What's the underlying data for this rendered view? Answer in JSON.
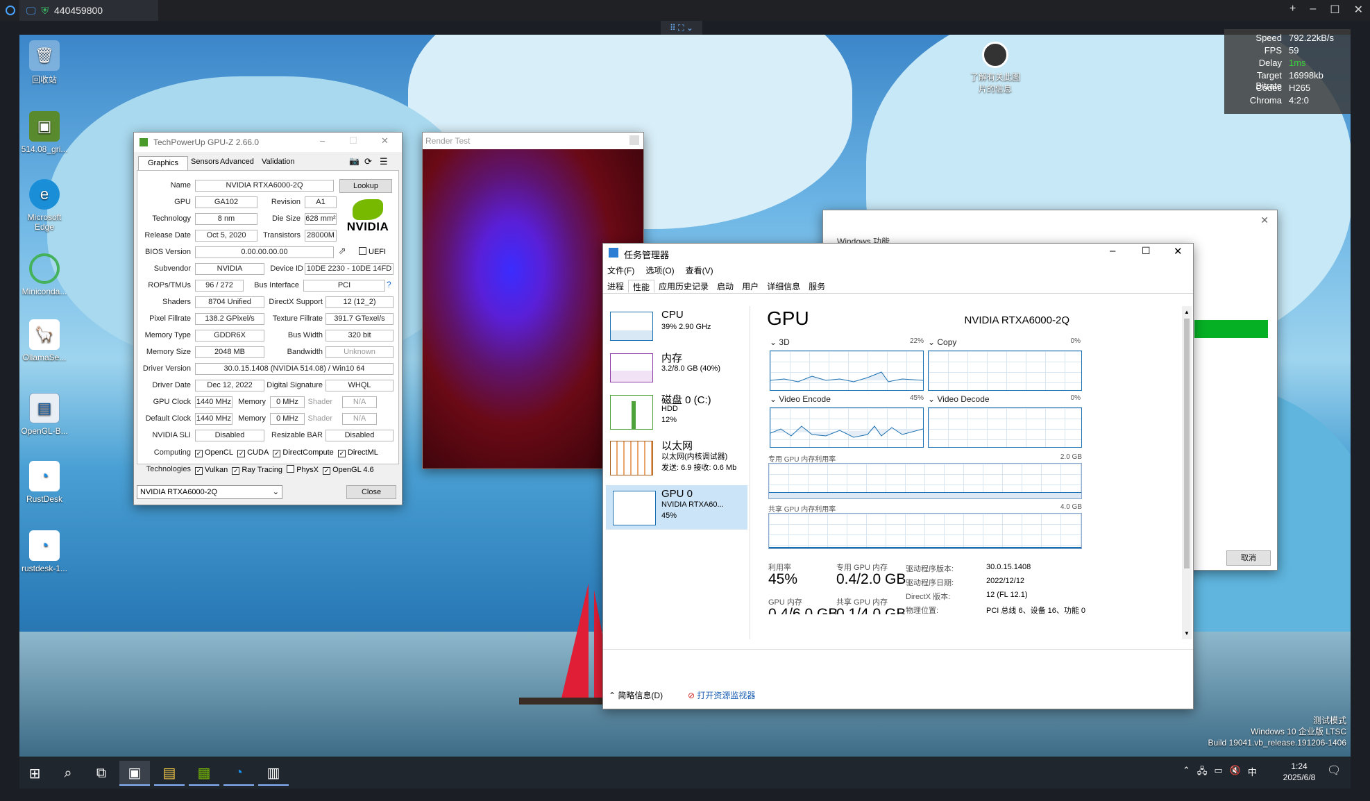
{
  "session": {
    "id": "440459800"
  },
  "stream_stats": [
    {
      "k": "Speed",
      "v": "792.22kB/s"
    },
    {
      "k": "FPS",
      "v": "59"
    },
    {
      "k": "Delay",
      "v": "1ms"
    },
    {
      "k": "Target Bitrate",
      "v": "16998kb"
    },
    {
      "k": "Codec",
      "v": "H265"
    },
    {
      "k": "Chroma",
      "v": "4:2:0"
    }
  ],
  "desktop_icons": [
    "回收站",
    "514.08_gri...",
    "Microsoft Edge",
    "Miniconda...",
    "OllamaSe...",
    "OpenGL-B...",
    "RustDesk",
    "rustdesk-1..."
  ],
  "spotlight_label": "了解有关此图片的信息",
  "watermark": {
    "mode": "测试模式",
    "edition": "Windows 10 企业版 LTSC",
    "build": "Build 19041.vb_release.191206-1406"
  },
  "gpuz": {
    "title": "TechPowerUp GPU-Z 2.66.0",
    "tabs": [
      "Graphics Card",
      "Sensors",
      "Advanced",
      "Validation"
    ],
    "lookup": "Lookup",
    "uefi": "UEFI",
    "close": "Close",
    "selected_gpu": "NVIDIA RTXA6000-2Q",
    "rows": {
      "name": {
        "label": "Name",
        "value": "NVIDIA RTXA6000-2Q"
      },
      "gpu": {
        "label": "GPU",
        "value": "GA102"
      },
      "revision": {
        "label": "Revision",
        "value": "A1"
      },
      "technology": {
        "label": "Technology",
        "value": "8 nm"
      },
      "die_size": {
        "label": "Die Size",
        "value": "628 mm²"
      },
      "release_date": {
        "label": "Release Date",
        "value": "Oct 5, 2020"
      },
      "transistors": {
        "label": "Transistors",
        "value": "28000M"
      },
      "bios": {
        "label": "BIOS Version",
        "value": "0.00.00.00.00"
      },
      "subvendor": {
        "label": "Subvendor",
        "value": "NVIDIA"
      },
      "device_id": {
        "label": "Device ID",
        "value": "10DE 2230 - 10DE 14FD"
      },
      "rops": {
        "label": "ROPs/TMUs",
        "value": "96 / 272"
      },
      "bus_interface": {
        "label": "Bus Interface",
        "value": "PCI"
      },
      "shaders": {
        "label": "Shaders",
        "value": "8704 Unified"
      },
      "directx": {
        "label": "DirectX Support",
        "value": "12 (12_2)"
      },
      "pixel_fillrate": {
        "label": "Pixel Fillrate",
        "value": "138.2 GPixel/s"
      },
      "texture_fillrate": {
        "label": "Texture Fillrate",
        "value": "391.7 GTexel/s"
      },
      "memory_type": {
        "label": "Memory Type",
        "value": "GDDR6X"
      },
      "bus_width": {
        "label": "Bus Width",
        "value": "320 bit"
      },
      "memory_size": {
        "label": "Memory Size",
        "value": "2048 MB"
      },
      "bandwidth": {
        "label": "Bandwidth",
        "value": "Unknown"
      },
      "driver_version": {
        "label": "Driver Version",
        "value": "30.0.15.1408 (NVIDIA 514.08) / Win10 64"
      },
      "driver_date": {
        "label": "Driver Date",
        "value": "Dec 12, 2022"
      },
      "digital_signature": {
        "label": "Digital Signature",
        "value": "WHQL"
      },
      "gpu_clock": {
        "label": "GPU Clock",
        "value": "1440 MHz"
      },
      "gpu_memory": {
        "label": "Memory",
        "value": "0 MHz"
      },
      "gpu_shader": {
        "label": "Shader",
        "value": "N/A"
      },
      "default_clock": {
        "label": "Default Clock",
        "value": "1440 MHz"
      },
      "default_memory": {
        "label": "Memory",
        "value": "0 MHz"
      },
      "default_shader": {
        "label": "Shader",
        "value": "N/A"
      },
      "sli": {
        "label": "NVIDIA SLI",
        "value": "Disabled"
      },
      "resizable_bar": {
        "label": "Resizable BAR",
        "value": "Disabled"
      }
    },
    "computing_label": "Computing",
    "computing": [
      {
        "name": "OpenCL",
        "on": true
      },
      {
        "name": "CUDA",
        "on": true
      },
      {
        "name": "DirectCompute",
        "on": true
      },
      {
        "name": "DirectML",
        "on": true
      }
    ],
    "technologies_label": "Technologies",
    "technologies": [
      {
        "name": "Vulkan",
        "on": true
      },
      {
        "name": "Ray Tracing",
        "on": true
      },
      {
        "name": "PhysX",
        "on": false
      },
      {
        "name": "OpenGL 4.6",
        "on": true
      }
    ]
  },
  "render_test": {
    "title": "Render Test"
  },
  "windows_features": {
    "title": "Windows 功能",
    "cancel": "取消"
  },
  "taskmgr": {
    "title": "任务管理器",
    "menu": [
      "文件(F)",
      "选项(O)",
      "查看(V)"
    ],
    "tabs": [
      "进程",
      "性能",
      "应用历史记录",
      "启动",
      "用户",
      "详细信息",
      "服务"
    ],
    "sidebar": [
      {
        "name": "CPU",
        "l1": "39% 2.90 GHz",
        "l2": "",
        "l3": ""
      },
      {
        "name": "内存",
        "l1": "3.2/8.0 GB (40%)",
        "l2": "",
        "l3": ""
      },
      {
        "name": "磁盘 0 (C:)",
        "l1": "HDD",
        "l2": "12%",
        "l3": ""
      },
      {
        "name": "以太网",
        "l1": "以太网(内核调试器)",
        "l2": "发送: 6.9 接收: 0.6 Mb",
        "l3": ""
      },
      {
        "name": "GPU 0",
        "l1": "NVIDIA RTXA60...",
        "l2": "45%",
        "l3": ""
      }
    ],
    "gpu_title": "GPU",
    "gpu_model": "NVIDIA RTXA6000-2Q",
    "engines": [
      {
        "name": "3D",
        "pct": "22%"
      },
      {
        "name": "Copy",
        "pct": "0%"
      },
      {
        "name": "Video Encode",
        "pct": "45%"
      },
      {
        "name": "Video Decode",
        "pct": "0%"
      }
    ],
    "dedicated_label": "专用 GPU 内存利用率",
    "dedicated_max": "2.0 GB",
    "shared_label": "共享 GPU 内存利用率",
    "shared_max": "4.0 GB",
    "stats": {
      "util_label": "利用率",
      "util": "45%",
      "ded_label": "专用 GPU 内存",
      "ded": "0.4/2.0 GB",
      "gpumem_label": "GPU 内存",
      "gpumem": "0.4/6.0 GB",
      "shared_label": "共享 GPU 内存",
      "shared": "0.1/4.0 GB"
    },
    "details": [
      {
        "k": "驱动程序版本:",
        "v": "30.0.15.1408"
      },
      {
        "k": "驱动程序日期:",
        "v": "2022/12/12"
      },
      {
        "k": "DirectX 版本:",
        "v": "12 (FL 12.1)"
      },
      {
        "k": "物理位置:",
        "v": "PCI 总线 6、设备 16、功能 0"
      }
    ],
    "footer_brief": "简略信息(D)",
    "footer_monitor": "打开资源监视器"
  },
  "taskbar": {
    "time": "1:24",
    "date": "2025/6/8",
    "ime": "中"
  }
}
